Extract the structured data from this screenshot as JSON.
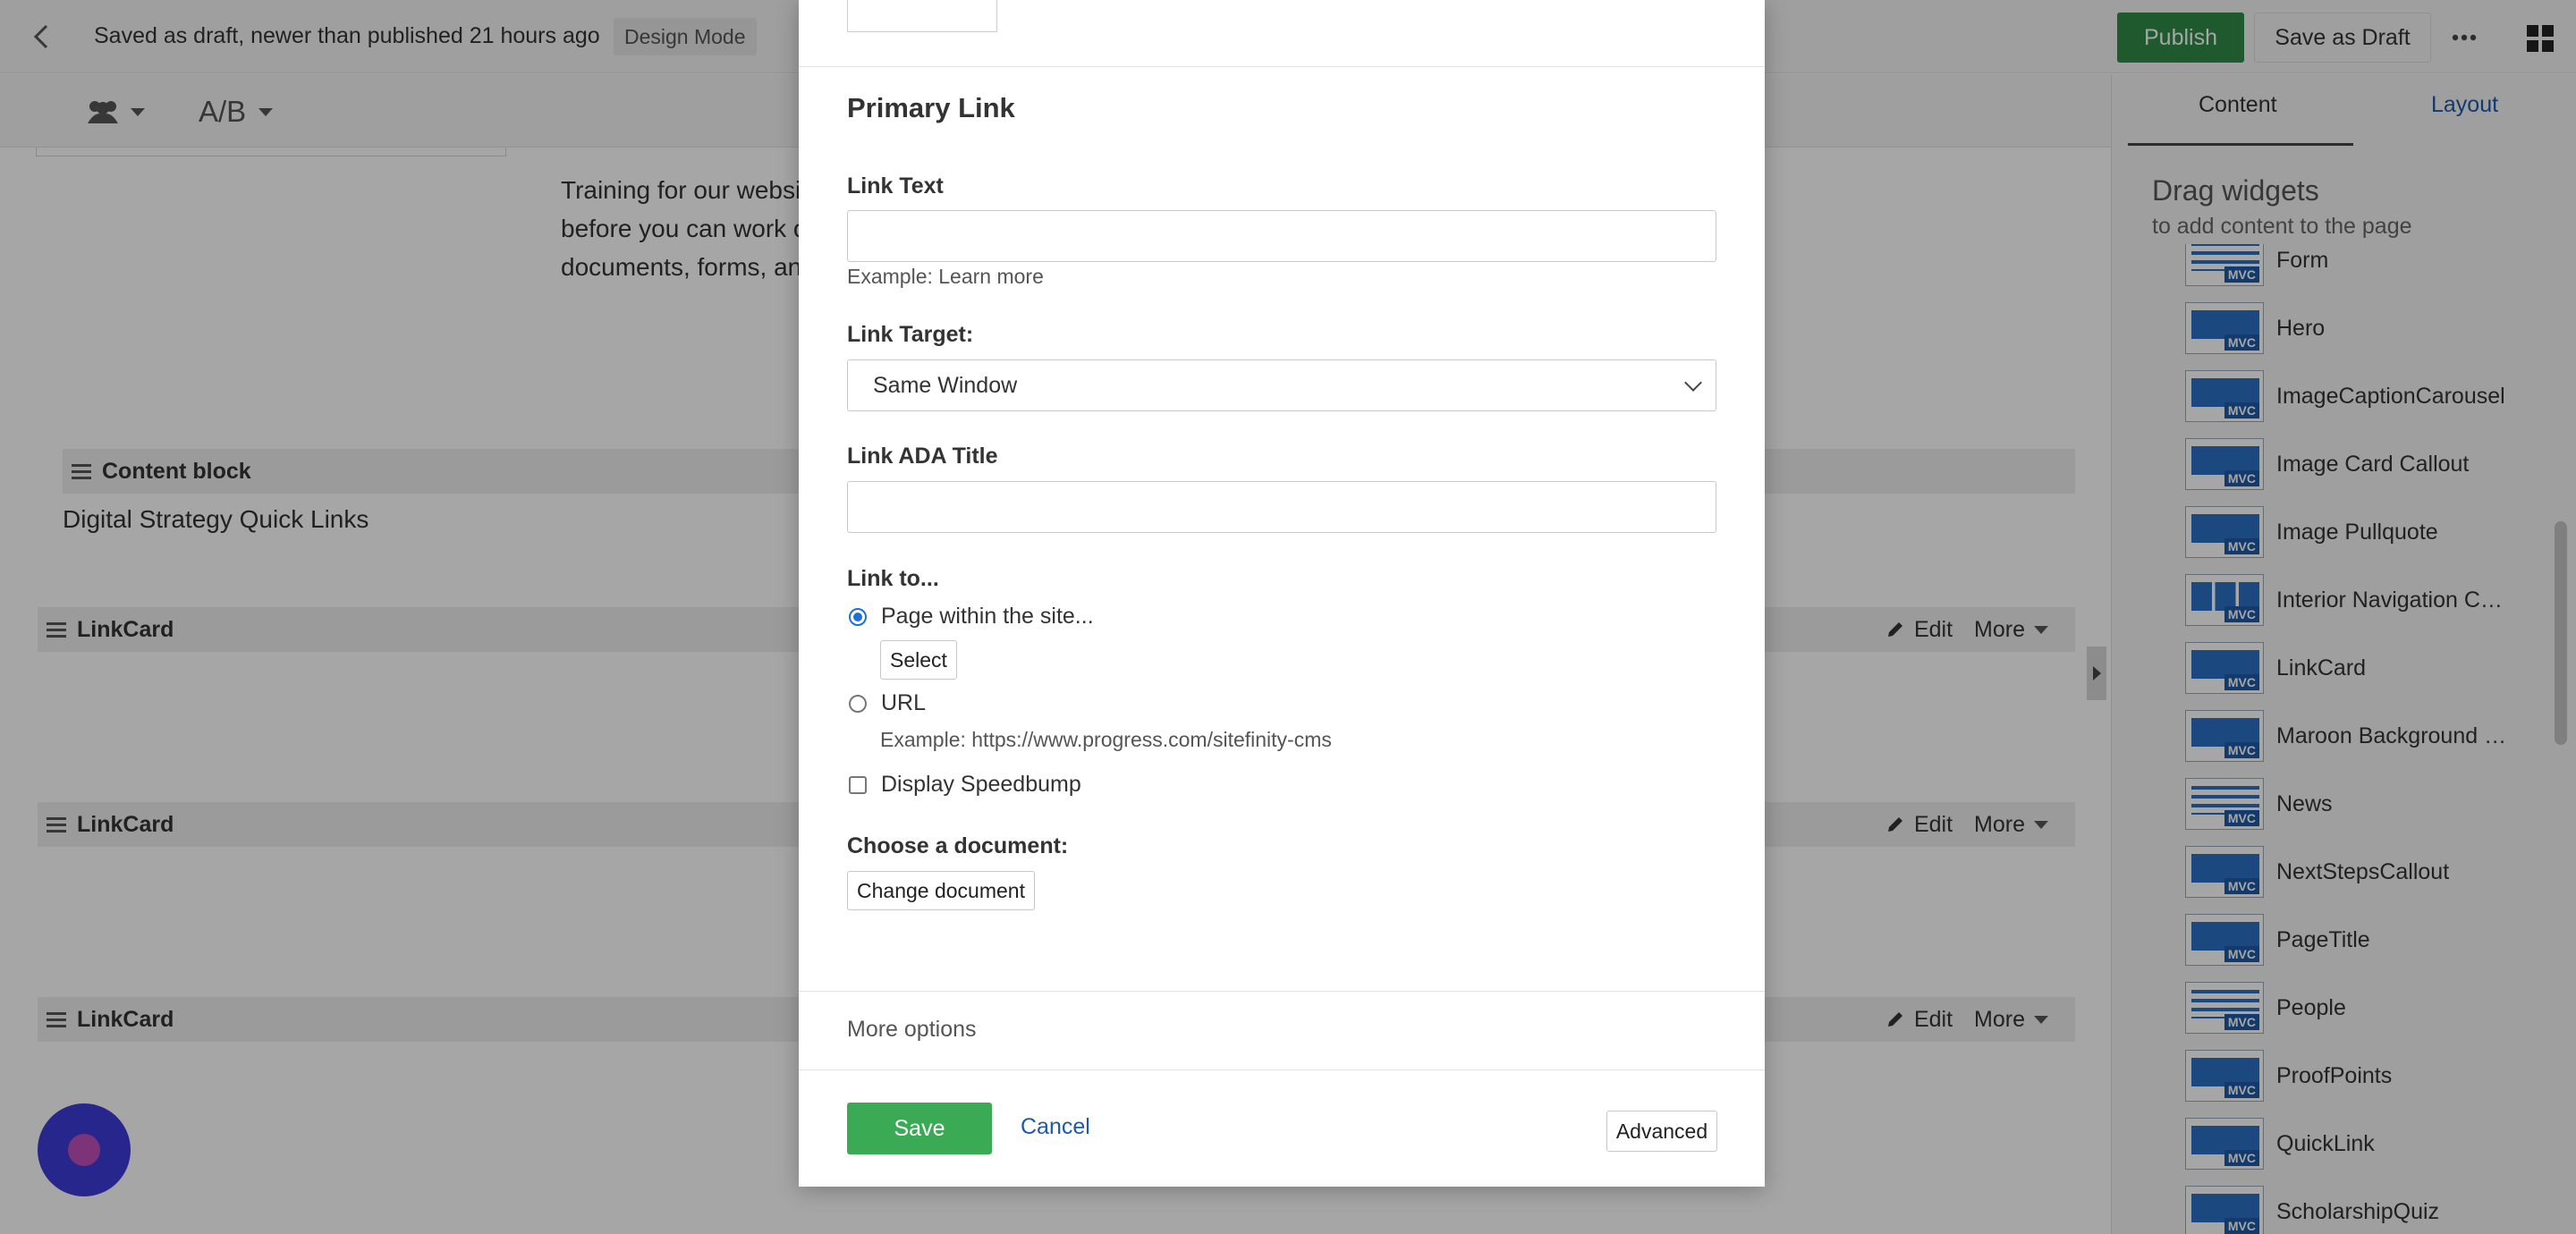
{
  "header": {
    "status_text": "Saved as draft, newer than published 21 hours ago",
    "mode_badge": "Design Mode",
    "publish_label": "Publish",
    "save_draft_label": "Save as Draft"
  },
  "toolbar": {
    "ab_label": "A/B"
  },
  "page": {
    "training_text": "Training for our website is required for all contributors. Training for collaborators is required\nbefore you can work on the website. Build your skills using images,\ndocuments, forms, and more.",
    "content_block_title": "Content block",
    "content_block_text": "Digital Strategy Quick Links",
    "linkcard_title": "LinkCard",
    "edit_label": "Edit",
    "more_label": "More"
  },
  "panel": {
    "tab_content": "Content",
    "tab_layout": "Layout",
    "drag_title": "Drag widgets",
    "drag_subtitle": "to add content to the page",
    "widgets": [
      {
        "label": "Form",
        "icon": "form-widget-icon"
      },
      {
        "label": "Hero",
        "icon": "hero-widget-icon"
      },
      {
        "label": "ImageCaptionCarousel",
        "icon": "carousel-widget-icon"
      },
      {
        "label": "Image Card Callout",
        "icon": "image-card-widget-icon"
      },
      {
        "label": "Image Pullquote",
        "icon": "pullquote-widget-icon"
      },
      {
        "label": "Interior Navigation C…",
        "icon": "navigation-widget-icon"
      },
      {
        "label": "LinkCard",
        "icon": "linkcard-widget-icon"
      },
      {
        "label": "Maroon Background …",
        "icon": "maroon-bg-widget-icon"
      },
      {
        "label": "News",
        "icon": "news-widget-icon"
      },
      {
        "label": "NextStepsCallout",
        "icon": "nextsteps-widget-icon"
      },
      {
        "label": "PageTitle",
        "icon": "pagetitle-widget-icon"
      },
      {
        "label": "People",
        "icon": "people-widget-icon"
      },
      {
        "label": "ProofPoints",
        "icon": "proofpoints-widget-icon"
      },
      {
        "label": "QuickLink",
        "icon": "quicklink-widget-icon"
      },
      {
        "label": "ScholarshipQuiz",
        "icon": "quiz-widget-icon"
      }
    ],
    "mvc_badge": "MVC"
  },
  "modal": {
    "section_title": "Primary Link",
    "link_text_label": "Link Text",
    "link_text_value": "",
    "link_text_hint": "Example: Learn more",
    "link_target_label": "Link Target:",
    "link_target_value": "Same Window",
    "ada_title_label": "Link ADA Title",
    "ada_title_value": "",
    "link_to_label": "Link to...",
    "option_page": "Page within the site...",
    "select_label": "Select",
    "option_url": "URL",
    "url_hint": "Example: https://www.progress.com/sitefinity-cms",
    "speedbump_label": "Display Speedbump",
    "document_label": "Choose a document:",
    "change_document_label": "Change document",
    "more_options_label": "More options",
    "save_label": "Save",
    "cancel_label": "Cancel",
    "advanced_label": "Advanced"
  },
  "colors": {
    "publish": "#2e8b47",
    "save": "#3aaa55",
    "link": "#1e5aa8",
    "chat_bubble": "#3d3bd8"
  }
}
